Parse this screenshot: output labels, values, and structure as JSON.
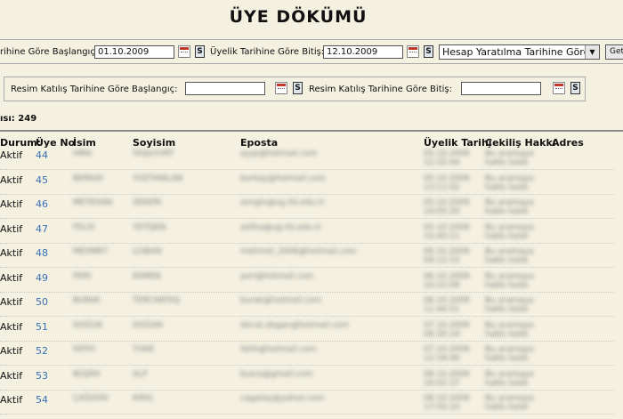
{
  "page": {
    "title": "ÜYE DÖKÜMÜ"
  },
  "filters": {
    "start_label": "rihine Göre Başlangıç:",
    "start_value": "01.10.2009",
    "end_label": "Üyelik Tarihine Göre Bitiş:",
    "end_value": "12.10.2009",
    "s_label": "S",
    "sort_select": "Hesap Yaratılma Tarihine Göre",
    "get_button": "Getir",
    "photo_start_label": "Resim Katılış Tarihine Göre Başlangıç:",
    "photo_start_value": "",
    "photo_end_label": "Resim Katılış Tarihine Göre Bitiş:",
    "photo_end_value": ""
  },
  "summary": {
    "count_text": "ısı: 249"
  },
  "table": {
    "headers": [
      "Durum:",
      "Üye No",
      "İsim",
      "Soyisim",
      "Eposta",
      "Üyelik Tarihi",
      "Çekiliş Hakkı",
      "Adres"
    ],
    "rows": [
      {
        "status": "Aktif",
        "no": "44",
        "name": "HİRA",
        "surname": "YAŞILYURT",
        "email": "ayşe@hotmail.com",
        "date": "05.10.2009 12:32:44",
        "draw": "Bu aramaya hakkı kaldı"
      },
      {
        "status": "Aktif",
        "no": "45",
        "name": "BERKAY",
        "surname": "YÜZTANILAN",
        "email": "berkay@hotmail.com",
        "date": "05.10.2009 13:11:02",
        "draw": "Bu aramaya hakkı kaldı"
      },
      {
        "status": "Aktif",
        "no": "46",
        "name": "METEHAN",
        "surname": "ZEKERİ",
        "email": "zengin@ug.itü.edu.tr",
        "date": "05.10.2009 14:05:20",
        "draw": "Bu aramaya hakkı kaldı"
      },
      {
        "status": "Aktif",
        "no": "47",
        "name": "FELİX",
        "surname": "YETİŞEN",
        "email": "zeliha@ug.itü.edu.tr",
        "date": "05.10.2009 15:40:11",
        "draw": "Bu aramaya hakkı kaldı"
      },
      {
        "status": "Aktif",
        "no": "48",
        "name": "MEHMET",
        "surname": "ÇOBAN",
        "email": "mehmet_2008@hotmail.com",
        "date": "06.10.2009 09:12:33",
        "draw": "Bu aramaya hakkı kaldı"
      },
      {
        "status": "Aktif",
        "no": "49",
        "name": "PERİ",
        "surname": "EKMEN",
        "email": "peri@hotmail.com",
        "date": "06.10.2009 10:22:08",
        "draw": "Bu aramaya hakkı kaldı"
      },
      {
        "status": "Aktif",
        "no": "50",
        "name": "BURAK",
        "surname": "TERCANTAŞ",
        "email": "burak@hotmail.com",
        "date": "06.10.2009 11:44:51",
        "draw": "Bu aramaya hakkı kaldı"
      },
      {
        "status": "Aktif",
        "no": "51",
        "name": "DOĞUK",
        "surname": "DOĞAN",
        "email": "doruk.dogan@hotmail.com",
        "date": "07.10.2009 08:30:19",
        "draw": "Bu aramaya hakkı kaldı"
      },
      {
        "status": "Aktif",
        "no": "52",
        "name": "FATİH",
        "surname": "TOKE",
        "email": "fatih@hotmail.com",
        "date": "07.10.2009 12:18:46",
        "draw": "Bu aramaya hakkı kaldı"
      },
      {
        "status": "Aktif",
        "no": "53",
        "name": "BÜŞRA",
        "surname": "ALP",
        "email": "busra@gmail.com",
        "date": "08.10.2009 16:02:37",
        "draw": "Bu aramaya hakkı kaldı"
      },
      {
        "status": "Aktif",
        "no": "54",
        "name": "ÇAĞATAY",
        "surname": "KIRIÇ",
        "email": "cagatay@yahoo.com",
        "date": "08.10.2009 17:55:10",
        "draw": "Bu aramaya hakkı kaldı"
      }
    ]
  }
}
